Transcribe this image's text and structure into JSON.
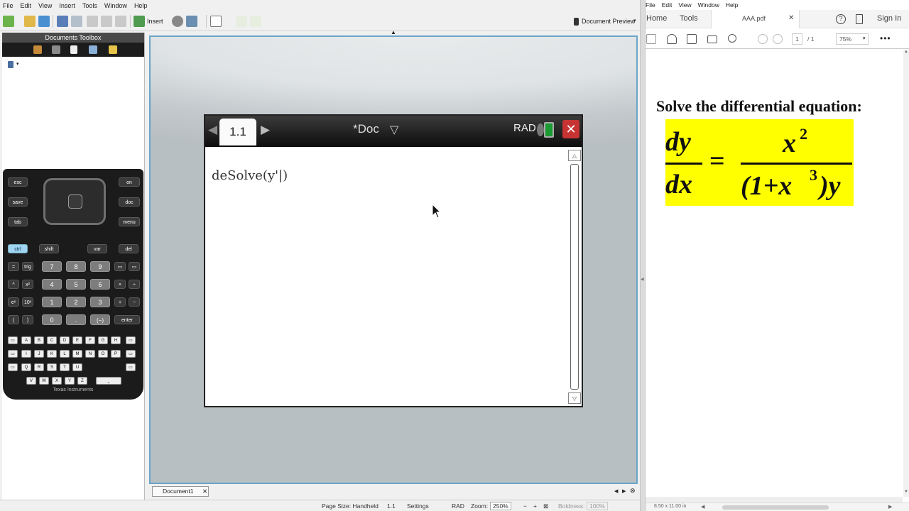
{
  "tns": {
    "menu": [
      "File",
      "Edit",
      "View",
      "Insert",
      "Tools",
      "Window",
      "Help"
    ],
    "toolbar": {
      "insert_label": "Insert",
      "doc_preview_label": "Document Preview"
    },
    "toolbox_title": "Documents Toolbox",
    "handheld": {
      "page_tab": "1.1",
      "doc_title": "*Doc",
      "angle_mode": "RAD",
      "expression_text": "deSolve(y'|)"
    },
    "doc_tab_label": "Document1",
    "statusbar": {
      "page_size": "Page Size: Handheld",
      "page": "1.1",
      "settings": "Settings",
      "angle": "RAD",
      "zoom_label": "Zoom:",
      "zoom_value": "250%",
      "boldness_label": "Boldness:",
      "boldness_value": "100%"
    },
    "calculator": {
      "brand": "Texas Instruments",
      "keys": {
        "esc": "esc",
        "save": "save",
        "tab": "tab",
        "on": "on",
        "doc": "doc",
        "menu": "menu",
        "ctrl": "ctrl",
        "shift": "shift",
        "var": "var",
        "del": "del",
        "eq": "=",
        "trig": "trig",
        "seven": "7",
        "eight": "8",
        "nine": "9",
        "caret": "^",
        "xsq": "x²",
        "four": "4",
        "five": "5",
        "six": "6",
        "times": "×",
        "div": "÷",
        "ex": "eˣ",
        "tenx": "10ˣ",
        "one": "1",
        "two": "2",
        "three": "3",
        "plus": "+",
        "minus": "−",
        "lparen": "(",
        "rparen": ")",
        "zero": "0",
        "dot": ".",
        "neg": "(−)",
        "enter": "enter",
        "letters": [
          "A",
          "B",
          "C",
          "D",
          "E",
          "F",
          "G",
          "H",
          "I",
          "J",
          "K",
          "L",
          "M",
          "N",
          "O",
          "P",
          "Q",
          "R",
          "S",
          "T",
          "U",
          "V",
          "W",
          "X",
          "Y",
          "Z"
        ]
      }
    }
  },
  "pdf": {
    "menu": [
      "File",
      "Edit",
      "View",
      "Window",
      "Help"
    ],
    "tabs": {
      "home": "Home",
      "tools": "Tools",
      "doc": "AAA.pdf",
      "signin": "Sign In",
      "help": "?"
    },
    "toolbar": {
      "page_current": "1",
      "page_total": "/ 1",
      "zoom": "75%"
    },
    "page": {
      "title": "Solve the differential equation:",
      "eq_lhs_num": "dy",
      "eq_lhs_den": "dx",
      "eq_equals": "=",
      "eq_rhs_num": "x",
      "eq_rhs_num_exp": "2",
      "eq_rhs_den_open": "(1+x",
      "eq_rhs_den_exp": "3",
      "eq_rhs_den_close": ")y"
    },
    "status_size": "8.50 x 11.00 in"
  },
  "colors": {
    "highlight": "#ffff00",
    "workspace_border": "#6aa4c8",
    "close_red": "#c73333",
    "battery_green": "#1b9a33"
  }
}
